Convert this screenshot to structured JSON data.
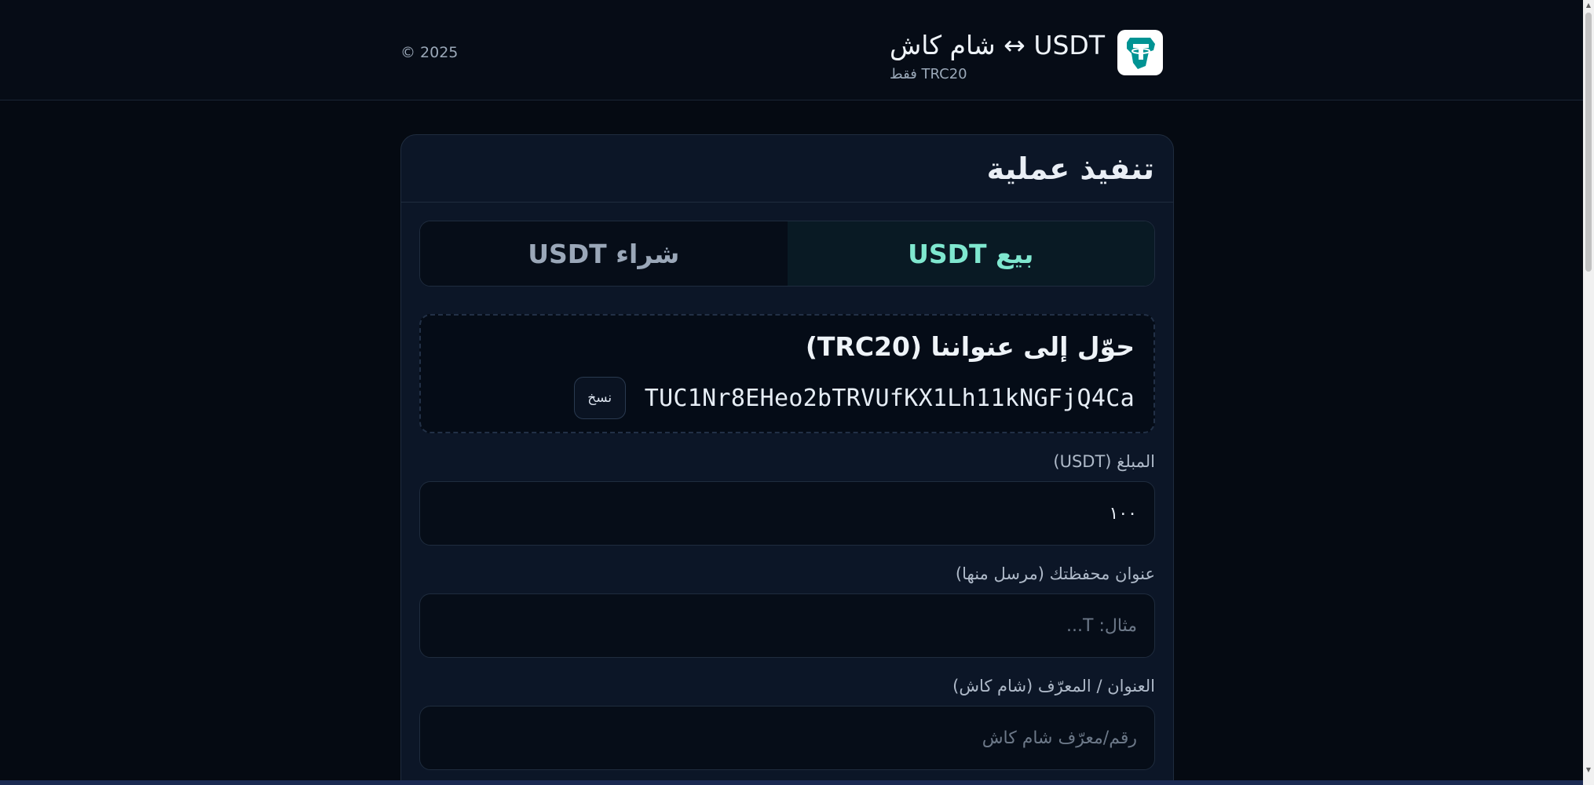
{
  "header": {
    "title": "USDT ↔ شام كاش",
    "subtitle": "TRC20 فقط",
    "copyright": "© 2025",
    "logo_icon": "tether-logo-icon"
  },
  "card": {
    "title": "تنفيذ عملية",
    "tabs": [
      {
        "label": "بيع USDT",
        "active": true
      },
      {
        "label": "شراء USDT",
        "active": false
      }
    ],
    "deposit": {
      "title": "حوّل إلى عنواننا (TRC20)",
      "address": "TUC1Nr8EHeo2bTRVUfKX1Lh11kNGFjQ4Ca",
      "copy_label": "نسخ"
    },
    "fields": [
      {
        "label": "المبلغ (USDT)",
        "value": "١٠٠",
        "placeholder": ""
      },
      {
        "label": "عنوان محفظتك (مرسل منها)",
        "value": "",
        "placeholder": "مثال: T..."
      },
      {
        "label": "العنوان / المعرّف (شام كاش)",
        "value": "",
        "placeholder": "رقم/معرّف شام كاش"
      }
    ]
  },
  "colors": {
    "background": "#050a12",
    "card": "#0c1627",
    "accent": "#7fe7cf",
    "logo": "#009393"
  }
}
